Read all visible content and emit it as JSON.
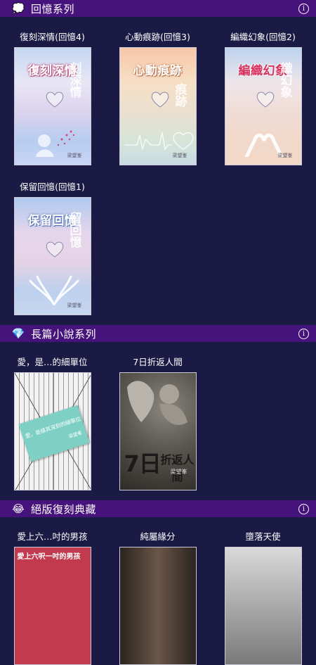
{
  "sections": [
    {
      "emoji": "💭",
      "title": "回憶系列",
      "info": "i"
    },
    {
      "emoji": "💎",
      "title": "長篇小說系列",
      "info": "i"
    },
    {
      "emoji": "😂",
      "title": "絕版復刻典藏",
      "info": "i"
    }
  ],
  "memory_books": [
    {
      "label": "復刻深情(回憶4)",
      "cover_title": "復刻深情",
      "vertical": "刻深情",
      "author": "梁望峯"
    },
    {
      "label": "心動痕跡(回憶3)",
      "cover_title": "心動痕跡",
      "vertical": "痕跡",
      "author": "梁望峯"
    },
    {
      "label": "編織幻象(回憶2)",
      "cover_title": "編織幻象",
      "vertical": "織幻象",
      "author": "梁望峯"
    },
    {
      "label": "保留回憶(回憶1)",
      "cover_title": "保留回憶",
      "vertical": "留回憶",
      "author": "梁望峯"
    }
  ],
  "novel_books": [
    {
      "label": "愛，是…的細單位",
      "cover_text": "愛，是極其深刻的細單位",
      "cover_sub": "梁望峯"
    },
    {
      "label": "7日折返人間",
      "cover_title_a": "7日",
      "cover_title_b": "折返人間",
      "author": "梁望峯"
    }
  ],
  "classic_books": [
    {
      "label": "愛上六…吋的男孩",
      "cover_title": "愛上六呎一吋的男孩"
    },
    {
      "label": "純屬緣分",
      "cover_title": ""
    },
    {
      "label": "墮落天使",
      "cover_title": ""
    }
  ]
}
